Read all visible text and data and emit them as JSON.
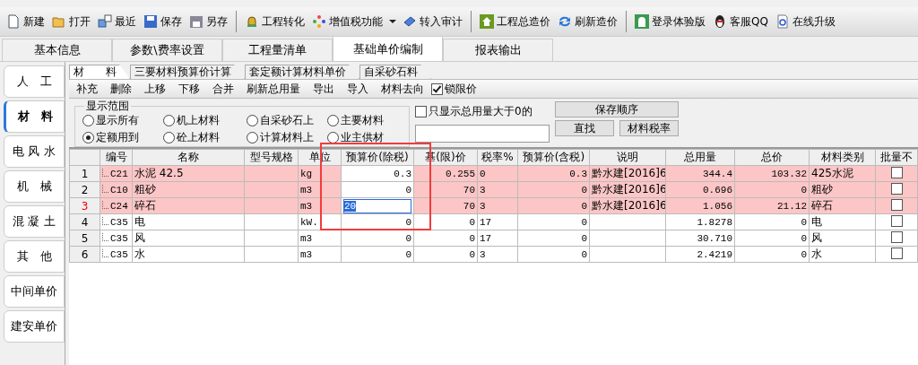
{
  "toolbar": {
    "groups": [
      [
        {
          "label": "新建",
          "kind": "new"
        },
        {
          "label": "打开",
          "kind": "open"
        },
        {
          "label": "最近",
          "kind": "recent"
        },
        {
          "label": "保存",
          "kind": "save"
        },
        {
          "label": "另存",
          "kind": "saveas"
        }
      ],
      [
        {
          "label": "工程转化",
          "kind": "convert"
        },
        {
          "label": "增值税功能",
          "kind": "vat",
          "dropdown": true
        },
        {
          "label": "转入审计",
          "kind": "audit"
        }
      ],
      [
        {
          "label": "工程总造价",
          "kind": "home"
        },
        {
          "label": "刷新造价",
          "kind": "refresh"
        }
      ],
      [
        {
          "label": "登录体验版",
          "kind": "login"
        },
        {
          "label": "客服QQ",
          "kind": "qq"
        },
        {
          "label": "在线升级",
          "kind": "upgrade"
        }
      ]
    ]
  },
  "tabs": [
    {
      "label": "基本信息",
      "selected": false
    },
    {
      "label": "参数\\费率设置",
      "selected": false
    },
    {
      "label": "工程量清单",
      "selected": false
    },
    {
      "label": "基础单价编制",
      "selected": true
    },
    {
      "label": "报表输出",
      "selected": false
    }
  ],
  "sidebar": {
    "items": [
      {
        "label": "人　工",
        "selected": false
      },
      {
        "label": "材　料",
        "selected": true
      },
      {
        "label": "电 风 水",
        "selected": false
      },
      {
        "label": "机　械",
        "selected": false
      },
      {
        "label": "混 凝 土",
        "selected": false
      },
      {
        "label": "其　他",
        "selected": false
      },
      {
        "label": "中间单价",
        "selected": false
      },
      {
        "label": "建安单价",
        "selected": false
      }
    ]
  },
  "sub_tabs": [
    {
      "label": "材　　料",
      "selected": true
    },
    {
      "label": "三要材料预算价计算",
      "selected": false
    },
    {
      "label": "套定额计算材料单价",
      "selected": false
    },
    {
      "label": "自采砂石料",
      "selected": false
    }
  ],
  "actions": [
    "补充",
    "删除",
    "上移",
    "下移",
    "合并",
    "刷新总用量",
    "导出",
    "导入",
    "材料去向"
  ],
  "lock_price": {
    "label": "锁限价",
    "checked": true
  },
  "filter": {
    "title": "显示范围",
    "options": [
      {
        "label": "显示所有",
        "selected": false
      },
      {
        "label": "机上材料",
        "selected": false
      },
      {
        "label": "自采砂石上",
        "selected": false
      },
      {
        "label": "主要材料",
        "selected": false
      },
      {
        "label": "定额用到",
        "selected": true
      },
      {
        "label": "砼上材料",
        "selected": false
      },
      {
        "label": "计算材料上",
        "selected": false
      },
      {
        "label": "业主供材",
        "selected": false
      }
    ]
  },
  "only_positive": {
    "label": "只显示总用量大于0的",
    "checked": false
  },
  "buttons": {
    "save_order": "保存顺序",
    "find": "直找",
    "tax_rate": "材料税率"
  },
  "table": {
    "columns": [
      "编号",
      "名称",
      "型号规格",
      "单位",
      "预算价(除税)",
      "基(限)价",
      "税率%",
      "预算价(含税)",
      "说明",
      "总用量",
      "总价",
      "材料类别",
      "批量不"
    ],
    "rows": [
      {
        "num": "1",
        "code": "C21",
        "name": "水泥 42.5",
        "unit": "kg",
        "price_ex": "0.3",
        "base_price": "0.255",
        "tax_rate": "0",
        "price_in": "0.3",
        "note": "黔水建[2016]6",
        "total_qty": "344.4",
        "total_price": "103.32",
        "category": "425水泥",
        "highlighted": true,
        "current": false,
        "editing": false,
        "batch": false
      },
      {
        "num": "2",
        "code": "C10",
        "name": "粗砂",
        "unit": "m3",
        "price_ex": "0",
        "base_price": "70",
        "tax_rate": "3",
        "price_in": "0",
        "note": "黔水建[2016]6",
        "total_qty": "0.696",
        "total_price": "0",
        "category": "粗砂",
        "highlighted": true,
        "current": false,
        "editing": false,
        "batch": false
      },
      {
        "num": "3",
        "code": "C24",
        "name": "碎石",
        "unit": "m3",
        "price_ex": "20",
        "base_price": "70",
        "tax_rate": "3",
        "price_in": "0",
        "note": "黔水建[2016]6",
        "total_qty": "1.056",
        "total_price": "21.12",
        "category": "碎石",
        "highlighted": true,
        "current": true,
        "editing": true,
        "batch": false
      },
      {
        "num": "4",
        "code": "C35",
        "name": "电",
        "unit": "kW.",
        "price_ex": "0",
        "base_price": "0",
        "tax_rate": "17",
        "price_in": "0",
        "total_qty": "1.8278",
        "total_price": "0",
        "category": "电",
        "highlighted": false,
        "current": false,
        "editing": false,
        "batch": false
      },
      {
        "num": "5",
        "code": "C35",
        "name": "风",
        "unit": "m3",
        "price_ex": "0",
        "base_price": "0",
        "tax_rate": "17",
        "price_in": "0",
        "total_qty": "30.710",
        "total_price": "0",
        "category": "风",
        "highlighted": false,
        "current": false,
        "editing": false,
        "batch": false
      },
      {
        "num": "6",
        "code": "C35",
        "name": "水",
        "unit": "m3",
        "price_ex": "0",
        "base_price": "0",
        "tax_rate": "3",
        "price_in": "0",
        "total_qty": "2.4219",
        "total_price": "0",
        "category": "水",
        "highlighted": false,
        "current": false,
        "editing": false,
        "batch": false
      }
    ]
  }
}
